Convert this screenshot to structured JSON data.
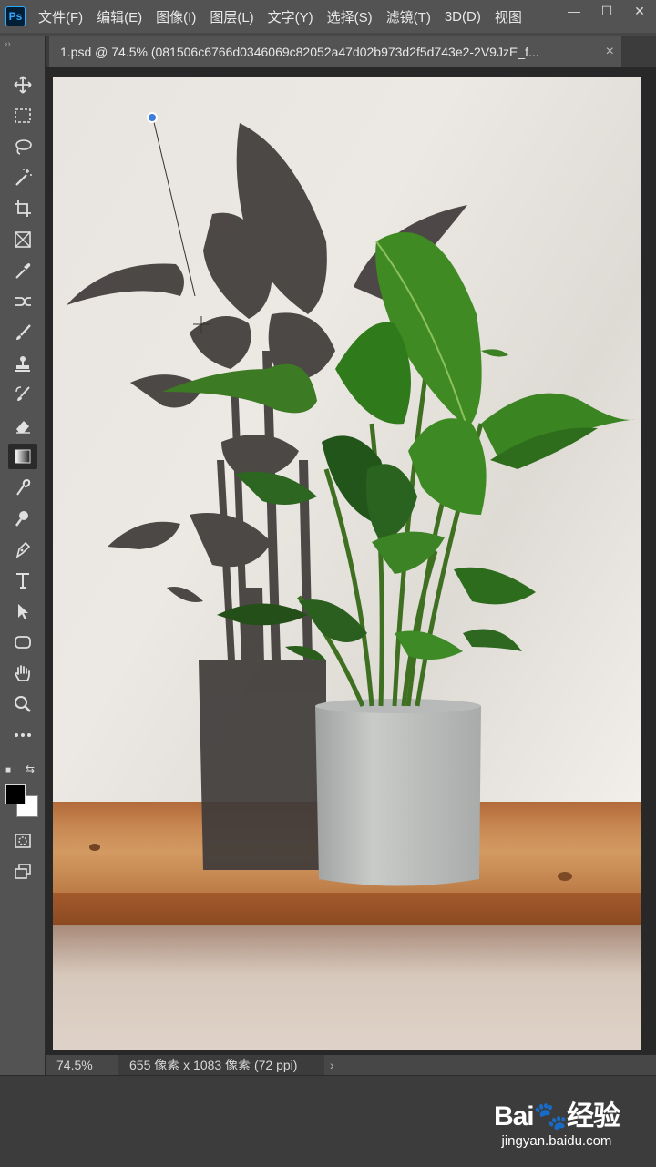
{
  "app": {
    "logo": "Ps"
  },
  "menu": [
    "文件(F)",
    "编辑(E)",
    "图像(I)",
    "图层(L)",
    "文字(Y)",
    "选择(S)",
    "滤镜(T)",
    "3D(D)",
    "视图"
  ],
  "window_controls": {
    "minimize": "—",
    "maximize": "☐",
    "close": "✕"
  },
  "document": {
    "tab_title": "1.psd @ 74.5% (081506c6766d0346069c82052a47d02b973d2f5d743e2-2V9JzE_f...",
    "close": "×"
  },
  "status": {
    "zoom": "74.5%",
    "doc_info": "655 像素 x 1083 像素 (72 ppi)",
    "arrow": "›"
  },
  "toolbar": {
    "grip": "››",
    "active_tool": "gradient-tool",
    "foreground_color": "#000000",
    "background_color": "#ffffff"
  },
  "watermark": {
    "logo": "Bai🐾经验",
    "url": "jingyan.baidu.com"
  }
}
